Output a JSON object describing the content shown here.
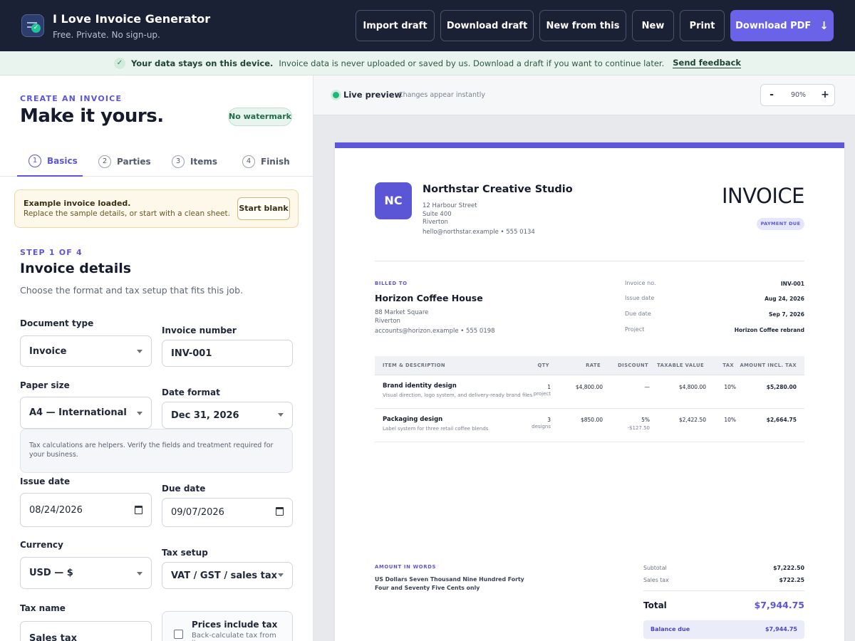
{
  "header": {
    "app_title": "I Love Invoice Generator",
    "app_subtitle": "Free. Private. No sign-up.",
    "buttons": {
      "import_draft": "Import draft",
      "download_draft": "Download draft",
      "new_from_this": "New from this",
      "new": "New",
      "print": "Print",
      "download_pdf": "Download PDF"
    }
  },
  "notice": {
    "strong": "Your data stays on this device.",
    "text": "Invoice data is never uploaded or saved by us. Download a draft if you want to continue later.",
    "feedback": "Send feedback"
  },
  "form": {
    "kicker": "CREATE AN INVOICE",
    "title": "Make it yours.",
    "watermark_badge": "No watermark",
    "tabs": [
      {
        "num": "1",
        "label": "Basics"
      },
      {
        "num": "2",
        "label": "Parties"
      },
      {
        "num": "3",
        "label": "Items"
      },
      {
        "num": "4",
        "label": "Finish"
      }
    ],
    "example": {
      "title": "Example invoice loaded.",
      "text": "Replace the sample details, or start with a clean sheet.",
      "button": "Start blank"
    },
    "step": "STEP 1 OF 4",
    "section_title": "Invoice details",
    "section_desc": "Choose the format and tax setup that fits this job.",
    "fields": {
      "document_type": {
        "label": "Document type",
        "value": "Invoice"
      },
      "invoice_number": {
        "label": "Invoice number",
        "value": "INV-001"
      },
      "paper_size": {
        "label": "Paper size",
        "value": "A4 — International"
      },
      "date_format": {
        "label": "Date format",
        "value": "Dec 31, 2026"
      },
      "issue_date": {
        "label": "Issue date",
        "value": "08/24/2026"
      },
      "due_date": {
        "label": "Due date",
        "value": "09/07/2026"
      },
      "currency": {
        "label": "Currency",
        "value": "USD — $"
      },
      "tax_setup": {
        "label": "Tax setup",
        "value": "VAT / GST / sales tax"
      },
      "tax_name": {
        "label": "Tax name",
        "value": "Sales tax"
      }
    },
    "tax_helper": "Tax calculations are helpers. Verify the fields and treatment required for your business.",
    "prices_include_tax": {
      "title": "Prices include tax",
      "sub": "Back-calculate tax from item"
    }
  },
  "preview": {
    "label": "Live preview",
    "sub": "Changes appear instantly",
    "zoom": {
      "minus": "-",
      "value": "90%",
      "plus": "+"
    }
  },
  "invoice": {
    "logo_initials": "NC",
    "company": {
      "name": "Northstar Creative Studio",
      "lines": [
        "12 Harbour Street",
        "Suite 400",
        "Riverton",
        "hello@northstar.example • 555 0134"
      ]
    },
    "doc_title": "INVOICE",
    "status_badge": "PAYMENT DUE",
    "billed_to_label": "BILLED TO",
    "client": {
      "name": "Horizon Coffee House",
      "lines": [
        "88 Market Square",
        "Riverton",
        "accounts@horizon.example • 555 0198"
      ]
    },
    "meta": [
      {
        "k": "Invoice no.",
        "v": "INV-001"
      },
      {
        "k": "Issue date",
        "v": "Aug 24, 2026"
      },
      {
        "k": "Due date",
        "v": "Sep 7, 2026"
      },
      {
        "k": "Project",
        "v": "Horizon Coffee rebrand"
      }
    ],
    "columns": {
      "item": "ITEM & DESCRIPTION",
      "qty": "QTY",
      "rate": "RATE",
      "discount": "DISCOUNT",
      "taxable": "TAXABLE VALUE",
      "tax": "TAX",
      "amount": "AMOUNT INCL. TAX"
    },
    "items": [
      {
        "name": "Brand identity design",
        "desc": "Visual direction, logo system, and delivery-ready brand files",
        "qty": "1",
        "unit": "project",
        "rate": "$4,800.00",
        "discount": "—",
        "discount_amt": "",
        "taxable": "$4,800.00",
        "tax": "10%",
        "amount": "$5,280.00"
      },
      {
        "name": "Packaging design",
        "desc": "Label system for three retail coffee blends",
        "qty": "3",
        "unit": "designs",
        "rate": "$850.00",
        "discount": "5%",
        "discount_amt": "-$127.50",
        "taxable": "$2,422.50",
        "tax": "10%",
        "amount": "$2,664.75"
      }
    ],
    "amount_in_words_label": "AMOUNT IN WORDS",
    "amount_in_words": "US Dollars Seven Thousand Nine Hundred Forty Four and Seventy Five Cents only",
    "subtotal_label": "Subtotal",
    "subtotal": "$7,222.50",
    "tax_label": "Sales tax",
    "tax": "$722.25",
    "total_label": "Total",
    "total": "$7,944.75",
    "balance_label": "Balance due",
    "balance": "$7,944.75"
  }
}
